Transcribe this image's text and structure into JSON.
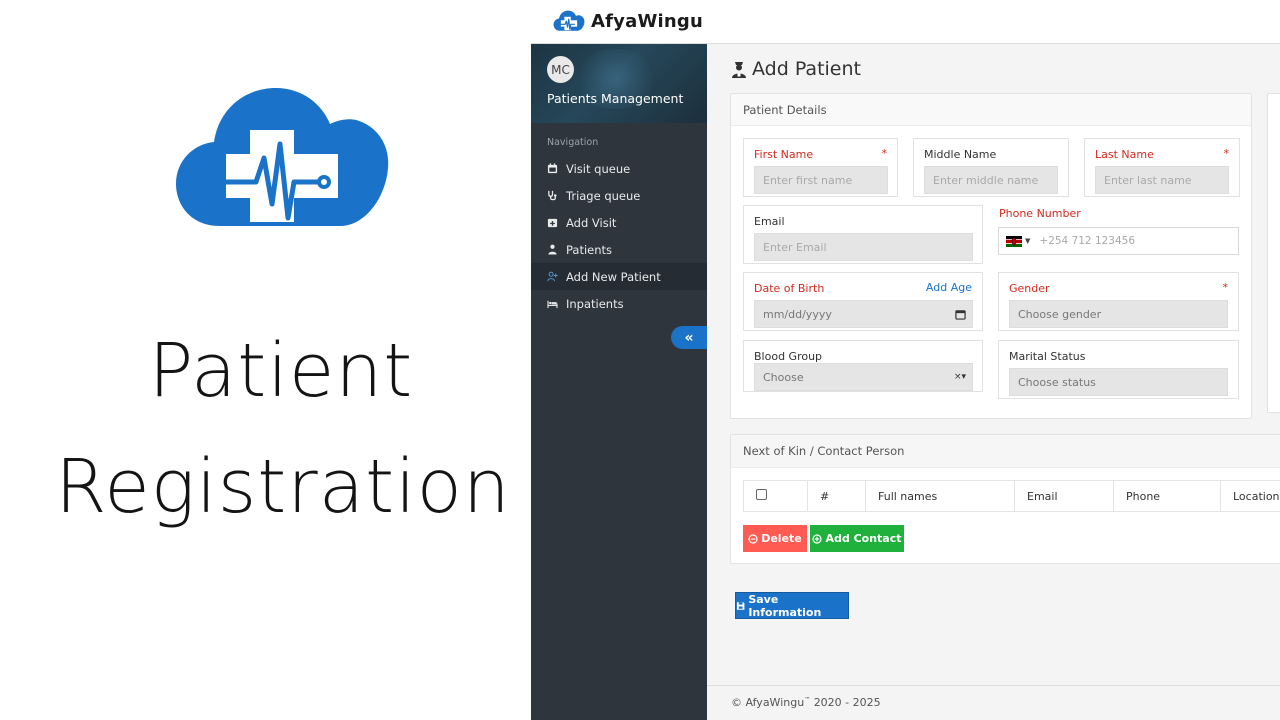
{
  "promo": {
    "title_line1": "Patient",
    "title_line2": "Registration",
    "logo_icon": "cloud-medical-cross-icon",
    "brand_color": "#1a73c8"
  },
  "topbar": {
    "brand_name": "AfyaWingu"
  },
  "sidebar": {
    "avatar_initials": "MC",
    "section_title": "Patients Management",
    "nav_heading": "Navigation",
    "items": [
      {
        "label": "Visit queue",
        "icon": "calendar-icon"
      },
      {
        "label": "Triage queue",
        "icon": "stethoscope-icon"
      },
      {
        "label": "Add Visit",
        "icon": "calendar-plus-icon"
      },
      {
        "label": "Patients",
        "icon": "user-doctor-icon"
      },
      {
        "label": "Add New Patient",
        "icon": "user-plus-icon",
        "active": true
      },
      {
        "label": "Inpatients",
        "icon": "bed-icon"
      }
    ],
    "collapse_glyph": "«"
  },
  "page": {
    "title": "Add Patient"
  },
  "patient_details": {
    "heading": "Patient Details",
    "first_name": {
      "label": "First Name",
      "placeholder": "Enter first name",
      "required": "*"
    },
    "middle_name": {
      "label": "Middle Name",
      "placeholder": "Enter middle name"
    },
    "last_name": {
      "label": "Last Name",
      "placeholder": "Enter last name",
      "required": "*"
    },
    "email": {
      "label": "Email",
      "placeholder": "Enter Email"
    },
    "phone": {
      "label": "Phone Number",
      "placeholder": "+254 712 123456",
      "flag": "kenya-flag-icon"
    },
    "dob": {
      "label": "Date of Birth",
      "placeholder": "mm/dd/yyyy",
      "add_age": "Add Age"
    },
    "gender": {
      "label": "Gender",
      "placeholder": "Choose gender",
      "required": "*"
    },
    "blood_group": {
      "label": "Blood Group",
      "value": "Choose"
    },
    "marital_status": {
      "label": "Marital Status",
      "placeholder": "Choose status"
    }
  },
  "next_of_kin": {
    "heading": "Next of Kin / Contact Person",
    "columns": [
      "#",
      "Full names",
      "Email",
      "Phone",
      "Location"
    ],
    "delete_label": "Delete",
    "add_label": "Add Contact"
  },
  "save_label": "Save Information",
  "footer": {
    "text_prefix": "© AfyaWingu",
    "tm": "™",
    "years": "2020 - 2025"
  }
}
